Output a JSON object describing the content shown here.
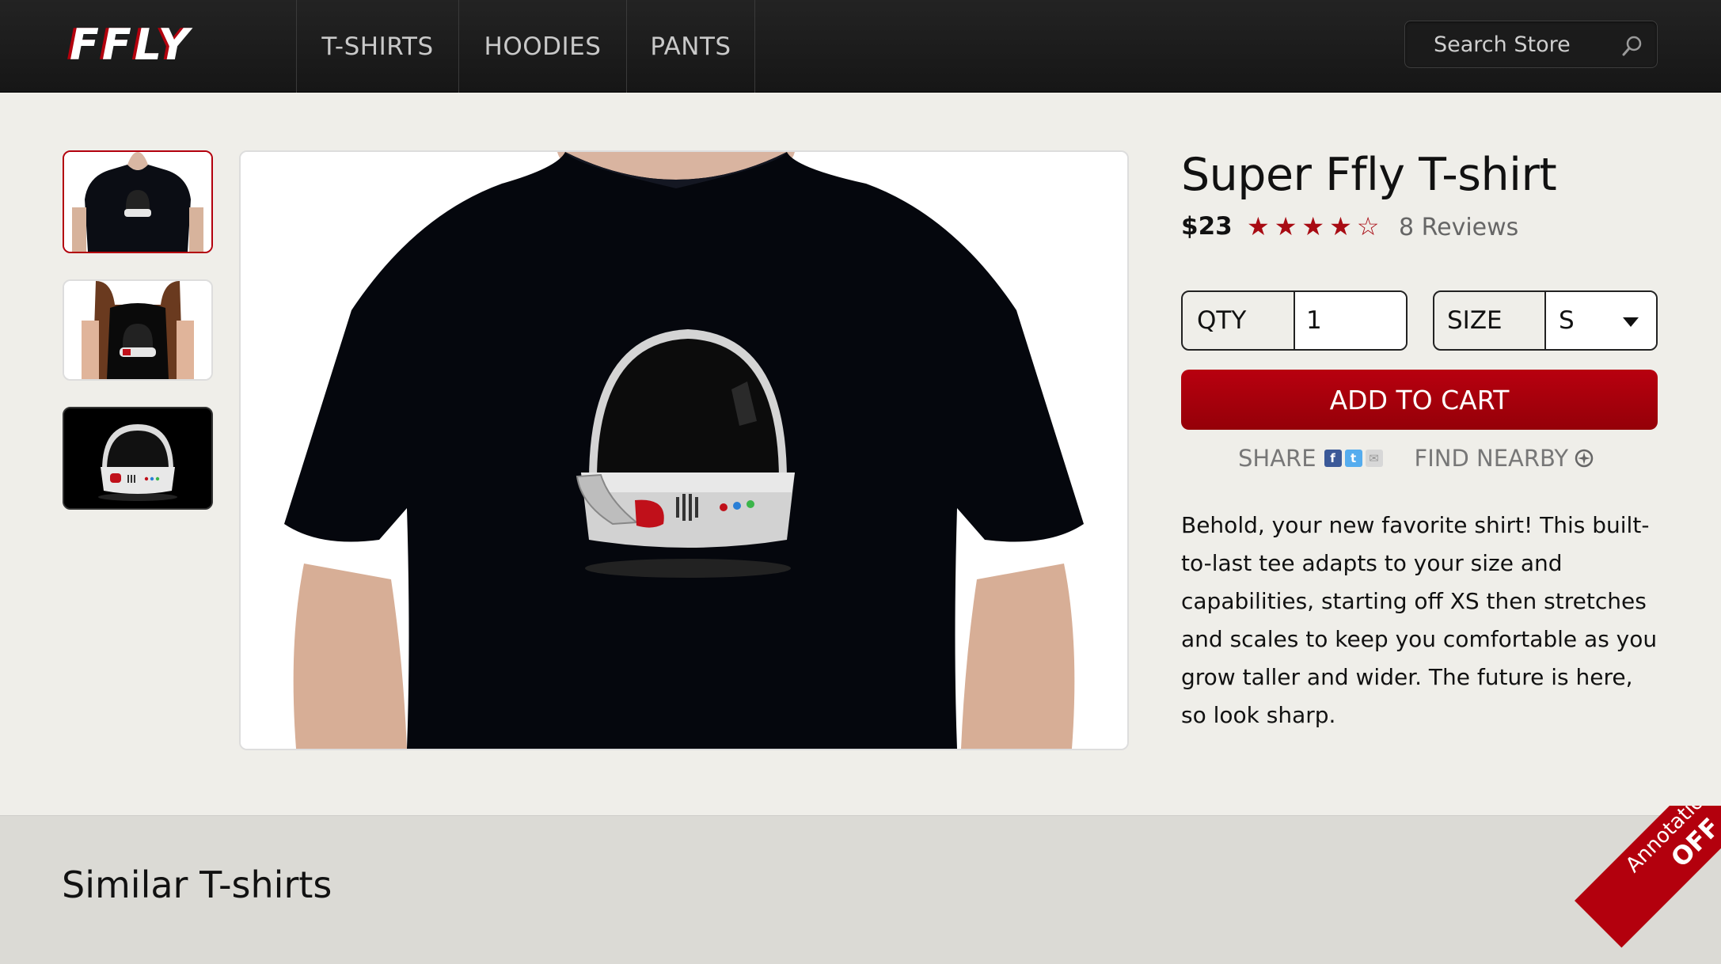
{
  "header": {
    "logo": "FFLY",
    "nav": [
      "T-SHIRTS",
      "HOODIES",
      "PANTS"
    ],
    "search_placeholder": "Search Store"
  },
  "product": {
    "title": "Super Ffly T-shirt",
    "price": "$23",
    "rating": 4,
    "rating_max": 5,
    "reviews_label": "8 Reviews",
    "qty_label": "QTY",
    "qty_value": "1",
    "size_label": "SIZE",
    "size_value": "S",
    "add_to_cart": "ADD TO CART",
    "share_label": "SHARE",
    "find_nearby_label": "FIND NEARBY",
    "description": "Behold, your new favorite shirt! This built-to-last tee adapts to your size and capabilities, starting off XS then stretches and scales to keep you comfortable as you grow taller and wider. The future is here, so look sharp."
  },
  "similar": {
    "title": "Similar T-shirts"
  },
  "ribbon": {
    "line1": "Annotations:",
    "line2": "OFF"
  },
  "colors": {
    "accent": "#b3000d",
    "star": "#a80b13",
    "topbar": "#1b1b1b",
    "page_bg": "#efeee9"
  },
  "icons": [
    "search-icon",
    "star-icon",
    "facebook-icon",
    "twitter-icon",
    "mail-icon",
    "compass-icon",
    "chevron-down-icon"
  ]
}
